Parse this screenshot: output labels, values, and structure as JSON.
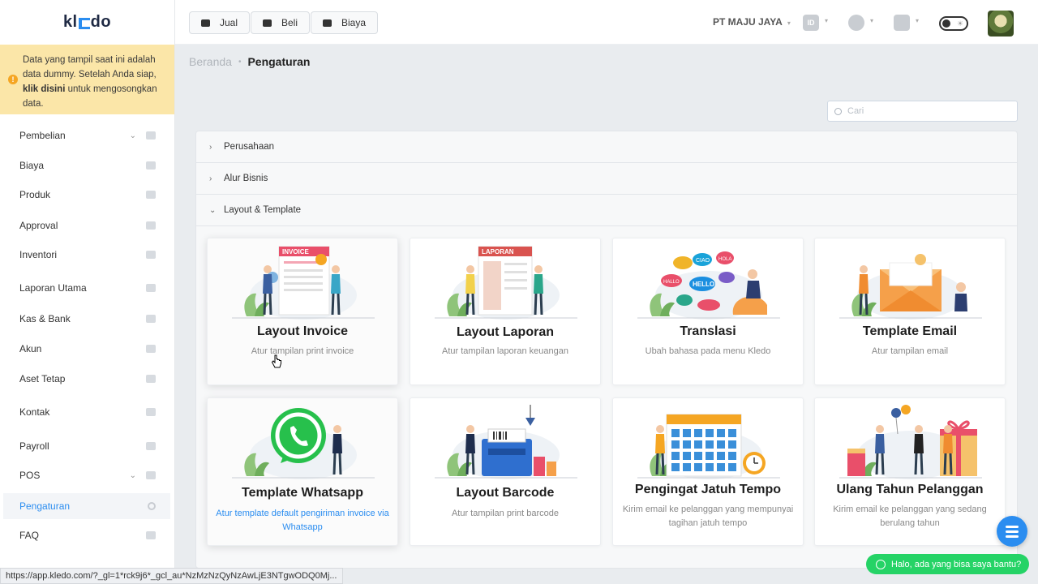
{
  "app": {
    "logo": "kledo"
  },
  "notice": {
    "text_before": "Data yang tampil saat ini adalah data dummy. Setelah Anda siap, ",
    "link": "klik disini",
    "text_after": " untuk mengosongkan data."
  },
  "sidebar": {
    "items": [
      {
        "label": "Pembelian",
        "icon": "basket-icon",
        "has_chevron": true
      },
      {
        "label": "Biaya",
        "icon": "card-icon"
      },
      {
        "label": "Produk",
        "icon": "box-icon"
      },
      {
        "label": "Approval",
        "icon": "check-icon"
      },
      {
        "label": "Inventori",
        "icon": "briefcase-icon"
      },
      {
        "label": "Laporan Utama",
        "icon": "chart-icon"
      },
      {
        "label": "Kas & Bank",
        "icon": "dollar-icon"
      },
      {
        "label": "Akun",
        "icon": "list-icon"
      },
      {
        "label": "Aset Tetap",
        "icon": "building-icon"
      },
      {
        "label": "Kontak",
        "icon": "contact-icon"
      },
      {
        "label": "Payroll",
        "icon": "cycle-icon"
      },
      {
        "label": "POS",
        "icon": "pos-icon",
        "has_chevron": true
      },
      {
        "label": "Pengaturan",
        "icon": "gears-icon",
        "active": true
      },
      {
        "label": "FAQ",
        "icon": "question-icon"
      }
    ]
  },
  "topbar": {
    "buttons": [
      {
        "label": "Jual",
        "icon": "basket-icon"
      },
      {
        "label": "Beli",
        "icon": "bag-icon"
      },
      {
        "label": "Biaya",
        "icon": "card-icon"
      }
    ],
    "company": "PT MAJU JAYA",
    "lang": "ID"
  },
  "breadcrumb": {
    "home": "Beranda",
    "current": "Pengaturan"
  },
  "search": {
    "placeholder": "Cari"
  },
  "accordion": {
    "sections": [
      {
        "label": "Perusahaan",
        "expanded": false
      },
      {
        "label": "Alur Bisnis",
        "expanded": false
      },
      {
        "label": "Layout & Template",
        "expanded": true
      }
    ]
  },
  "cards": [
    {
      "title": "Layout Invoice",
      "desc": "Atur tampilan print invoice",
      "illus": "invoice"
    },
    {
      "title": "Layout Laporan",
      "desc": "Atur tampilan laporan keuangan",
      "illus": "laporan"
    },
    {
      "title": "Translasi",
      "desc": "Ubah bahasa pada menu Kledo",
      "illus": "translasi"
    },
    {
      "title": "Template Email",
      "desc": "Atur tampilan email",
      "illus": "email"
    },
    {
      "title": "Template Whatsapp",
      "desc": "Atur template default pengiriman invoice via Whatsapp",
      "illus": "whatsapp",
      "desc_blue": true
    },
    {
      "title": "Layout Barcode",
      "desc": "Atur tampilan print barcode",
      "illus": "barcode"
    },
    {
      "title": "Pengingat Jatuh Tempo",
      "desc": "Kirim email ke pelanggan yang mempunyai tagihan jatuh tempo",
      "illus": "calendar"
    },
    {
      "title": "Ulang Tahun Pelanggan",
      "desc": "Kirim email ke pelanggan yang sedang berulang tahun",
      "illus": "birthday"
    }
  ],
  "illus_text": {
    "invoice": "INVOICE",
    "laporan": "LAPORAN",
    "ciao": "CIAO",
    "hello": "HELLO",
    "hallo": "HALLO",
    "hola": "HOLA"
  },
  "chat": {
    "label": "Halo, ada yang bisa saya bantu?"
  },
  "status_url": "https://app.kledo.com/?_gl=1*rck9j6*_gcl_au*NzMzNzQyNzAwLjE3NTgwODQ0Mj..."
}
